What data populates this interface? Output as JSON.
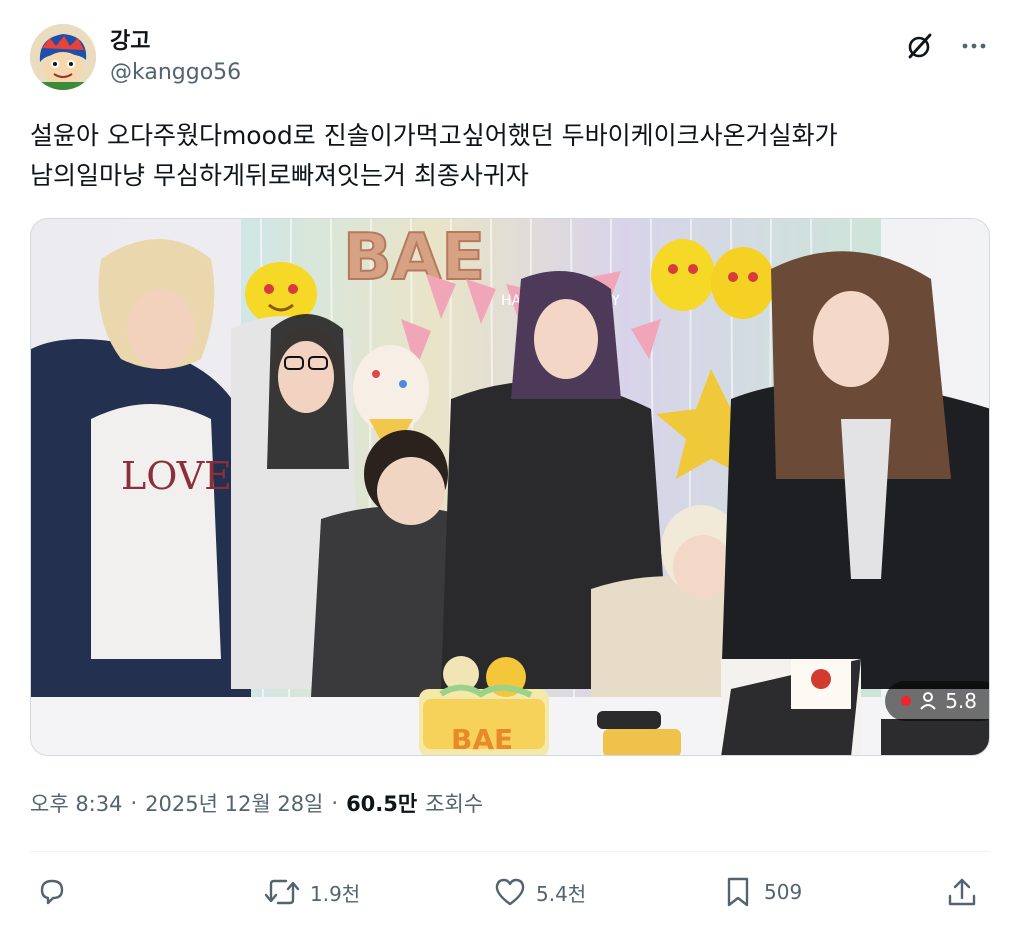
{
  "author": {
    "display_name": "강고",
    "handle": "@kanggo56",
    "avatar_icon": "cartoon-character-avatar"
  },
  "tweet": {
    "text": "설윤아 오다주웠다mood로 진솔이가먹고싶어했던 두바이케이크사온거실화가\n남의일마냥 무심하게뒤로빠져잇는거 최종사귀자"
  },
  "media": {
    "balloon_text": "BAE",
    "banner_text": "HAPPY BIRTHDAY",
    "cake_text": "BAE",
    "viewer_count": "5.8",
    "live_color": "#f4212e"
  },
  "meta": {
    "time": "오후 8:34",
    "date": "2025년 12월 28일",
    "views": "60.5만",
    "views_label": "조회수",
    "separator": "·"
  },
  "actions": {
    "reply": {
      "icon": "reply-icon",
      "count": ""
    },
    "retweet": {
      "icon": "retweet-icon",
      "count": "1.9천"
    },
    "like": {
      "icon": "heart-icon",
      "count": "5.4천"
    },
    "bookmark": {
      "icon": "bookmark-icon",
      "count": "509"
    },
    "share": {
      "icon": "share-icon",
      "count": ""
    }
  },
  "colors": {
    "text_primary": "#0f1419",
    "text_secondary": "#536471",
    "border": "#cfd9de"
  }
}
